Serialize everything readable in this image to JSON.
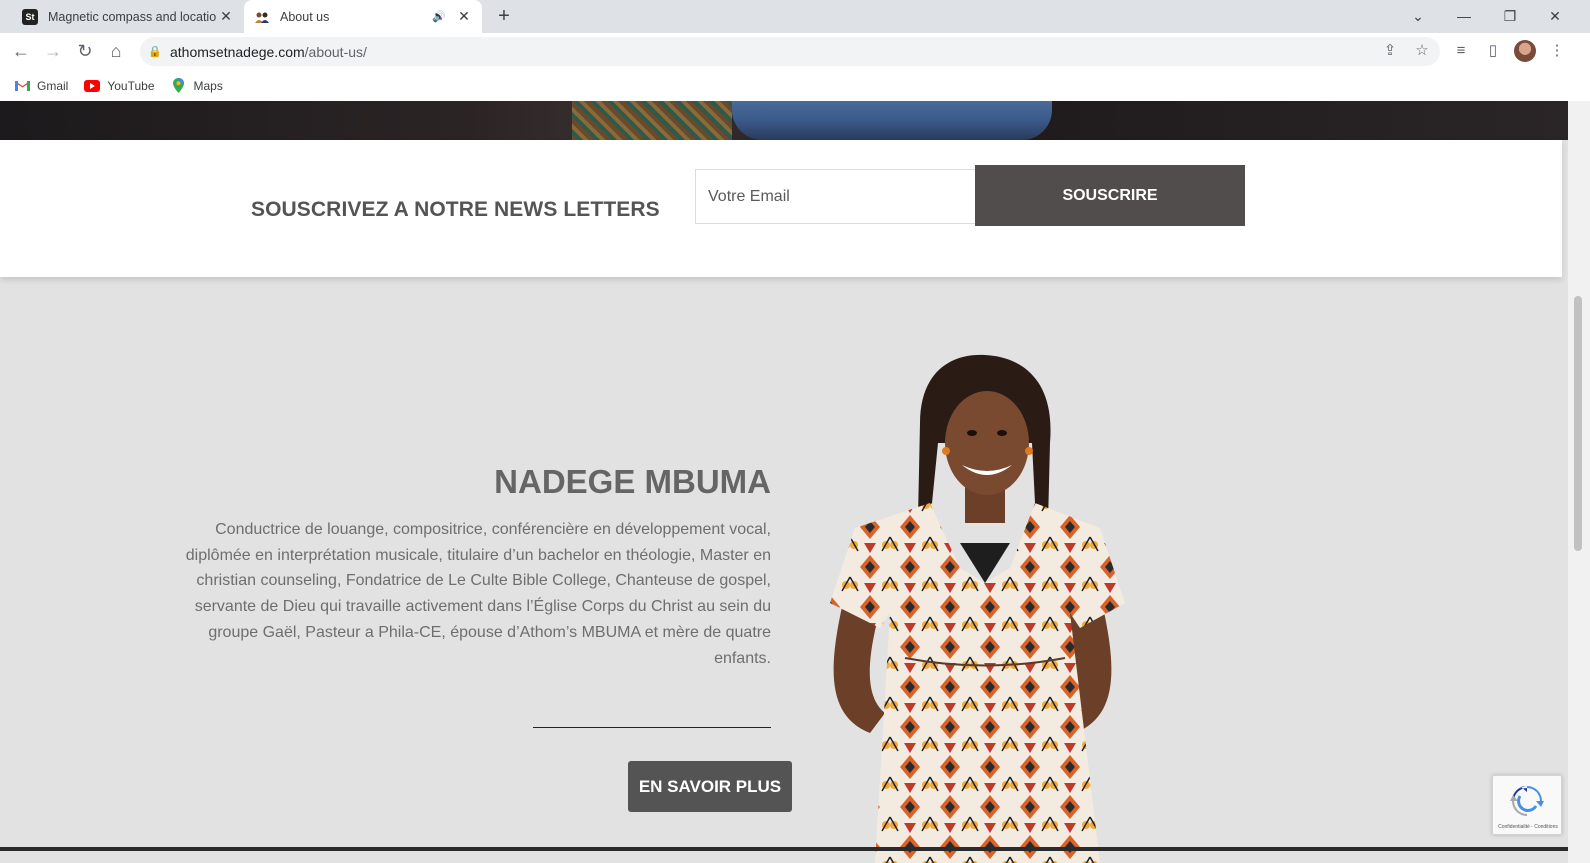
{
  "browser": {
    "tabs": [
      {
        "title": "Magnetic compass and location",
        "favicon": "St"
      },
      {
        "title": "About us"
      }
    ],
    "url_host": "athomsetnadege.com",
    "url_path": "/about-us/",
    "bookmarks": [
      {
        "label": "Gmail",
        "icon": "gmail-icon"
      },
      {
        "label": "YouTube",
        "icon": "youtube-icon"
      },
      {
        "label": "Maps",
        "icon": "maps-icon"
      }
    ]
  },
  "newsletter": {
    "heading": "SOUSCRIVEZ A NOTRE NEWS LETTERS",
    "email_placeholder": "Votre Email",
    "button_label": "SOUSCRIRE"
  },
  "profile": {
    "name": "NADEGE MBUMA",
    "bio": "Conductrice de louange, compositrice, conférencière en développement vocal, diplômée en interprétation musicale, titulaire d’un bachelor en théologie, Master en christian counseling, Fondatrice de Le Culte Bible College, Chanteuse de gospel, servante de Dieu qui travaille activement dans l’Église Corps du Christ au sein du groupe Gaël, Pasteur a Phila-CE, épouse d’Athom’s MBUMA et mère de quatre enfants.",
    "button_label": "EN SAVOIR PLUS"
  },
  "recaptcha": {
    "footer": "Confidentialité - Conditions"
  },
  "colors": {
    "button_dark": "#524d4d",
    "page_bg": "#e2e2e2",
    "heading_text": "#555353"
  }
}
